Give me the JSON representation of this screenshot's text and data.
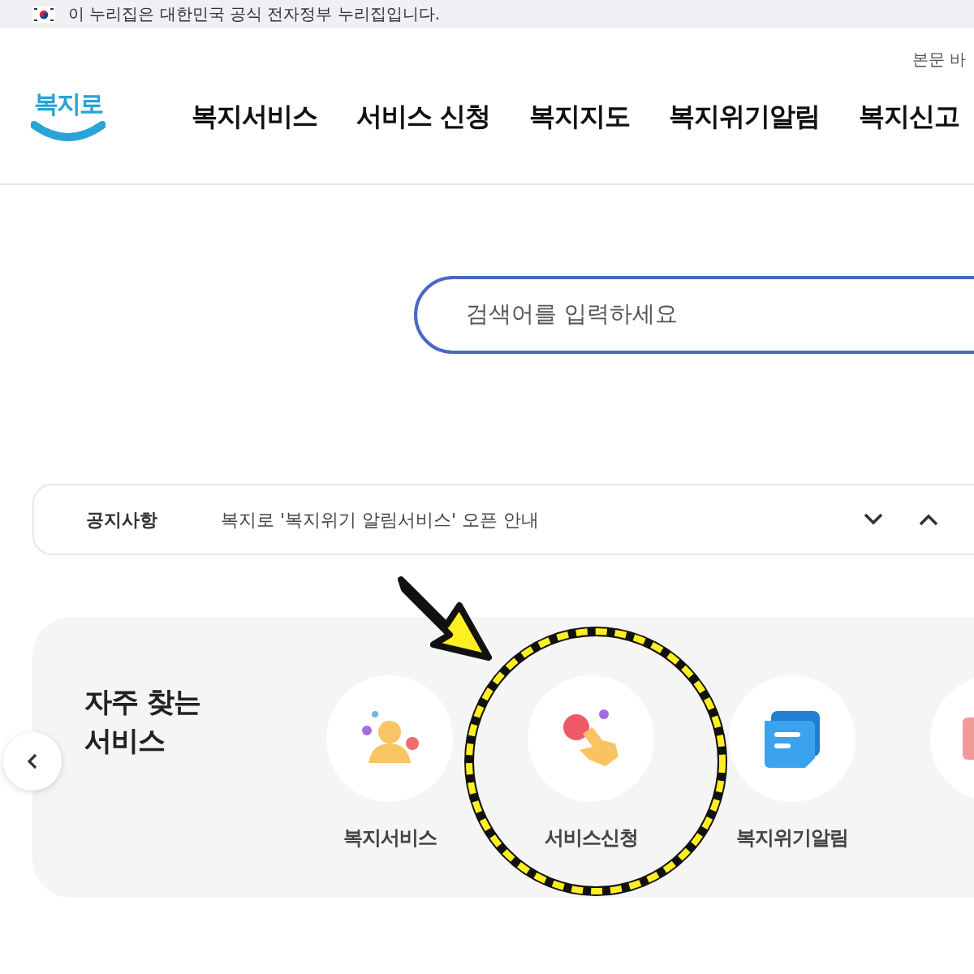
{
  "gov_banner": {
    "text": "이 누리집은 대한민국 공식 전자정부 누리집입니다."
  },
  "header": {
    "skip_link": "본문 바",
    "logo": "복지로",
    "nav": [
      "복지서비스",
      "서비스 신청",
      "복지지도",
      "복지위기알림",
      "복지신고"
    ]
  },
  "search": {
    "placeholder": "검색어를 입력하세요"
  },
  "notice": {
    "label": "공지사항",
    "text": "복지로 '복지위기 알림서비스' 오픈 안내"
  },
  "frequent": {
    "title": "자주 찾는\n서비스",
    "items": [
      {
        "label": "복지서비스",
        "kind": "person"
      },
      {
        "label": "서비스신청",
        "kind": "tap"
      },
      {
        "label": "복지위기알림",
        "kind": "message"
      },
      {
        "kind": "partial"
      }
    ]
  },
  "annotation": {
    "kind": "circle-with-arrow"
  }
}
